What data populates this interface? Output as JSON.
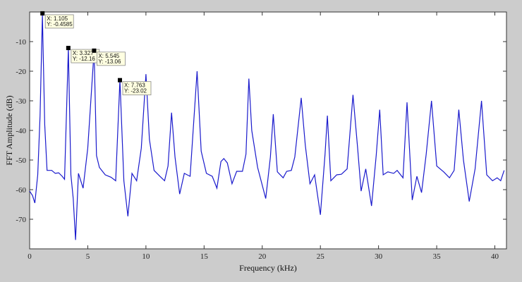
{
  "chart_data": {
    "type": "line",
    "title": "",
    "xlabel": "Frequency (kHz)",
    "ylabel": "FFT Amplitude (dB)",
    "xlim": [
      0,
      41
    ],
    "ylim": [
      -80,
      0
    ],
    "xticks": [
      0,
      5,
      10,
      15,
      20,
      25,
      30,
      35,
      40
    ],
    "yticks": [
      -10,
      -20,
      -30,
      -40,
      -50,
      -60,
      -70
    ],
    "grid": false,
    "series": [
      {
        "color": "#1a1acc",
        "points": [
          [
            0.0,
            -60.5
          ],
          [
            0.25,
            -62
          ],
          [
            0.45,
            -64.5
          ],
          [
            0.7,
            -55
          ],
          [
            0.9,
            -35
          ],
          [
            1.1,
            -1.0
          ],
          [
            1.3,
            -38
          ],
          [
            1.5,
            -53.5
          ],
          [
            1.9,
            -53.5
          ],
          [
            2.2,
            -54.5
          ],
          [
            2.5,
            -54.3
          ],
          [
            2.8,
            -55.5
          ],
          [
            3.0,
            -56.5
          ],
          [
            3.327,
            -12.3
          ],
          [
            3.55,
            -55
          ],
          [
            3.75,
            -63
          ],
          [
            3.95,
            -77
          ],
          [
            4.2,
            -54.5
          ],
          [
            4.6,
            -59.5
          ],
          [
            5.0,
            -46
          ],
          [
            5.545,
            -13.0
          ],
          [
            5.75,
            -48.5
          ],
          [
            6.0,
            -52.5
          ],
          [
            6.5,
            -55
          ],
          [
            7.0,
            -55.8
          ],
          [
            7.4,
            -57
          ],
          [
            7.763,
            -23.0
          ],
          [
            8.1,
            -57
          ],
          [
            8.45,
            -69
          ],
          [
            8.8,
            -54.5
          ],
          [
            9.2,
            -57
          ],
          [
            9.6,
            -46
          ],
          [
            10.0,
            -21
          ],
          [
            10.3,
            -43
          ],
          [
            10.7,
            -53.5
          ],
          [
            11.2,
            -55.5
          ],
          [
            11.6,
            -57
          ],
          [
            11.9,
            -52
          ],
          [
            12.2,
            -34
          ],
          [
            12.5,
            -49
          ],
          [
            12.9,
            -61.5
          ],
          [
            13.3,
            -54.5
          ],
          [
            13.8,
            -55.5
          ],
          [
            14.4,
            -20
          ],
          [
            14.75,
            -47
          ],
          [
            15.2,
            -54.5
          ],
          [
            15.7,
            -55.5
          ],
          [
            16.1,
            -59.5
          ],
          [
            16.45,
            -50.5
          ],
          [
            16.7,
            -49.5
          ],
          [
            17.0,
            -51
          ],
          [
            17.4,
            -58
          ],
          [
            17.8,
            -53.8
          ],
          [
            18.3,
            -53.8
          ],
          [
            18.6,
            -48
          ],
          [
            18.85,
            -22.5
          ],
          [
            19.1,
            -40
          ],
          [
            19.6,
            -52.5
          ],
          [
            20.3,
            -63
          ],
          [
            20.7,
            -49
          ],
          [
            20.95,
            -34.5
          ],
          [
            21.3,
            -54
          ],
          [
            21.8,
            -56
          ],
          [
            22.1,
            -53.8
          ],
          [
            22.5,
            -53.5
          ],
          [
            22.8,
            -49
          ],
          [
            23.35,
            -29
          ],
          [
            23.7,
            -45
          ],
          [
            24.1,
            -58
          ],
          [
            24.5,
            -55
          ],
          [
            25.0,
            -68.5
          ],
          [
            25.4,
            -48
          ],
          [
            25.6,
            -35
          ],
          [
            25.9,
            -57
          ],
          [
            26.4,
            -55
          ],
          [
            26.8,
            -54.8
          ],
          [
            27.3,
            -53
          ],
          [
            27.8,
            -28
          ],
          [
            28.2,
            -46
          ],
          [
            28.5,
            -60.5
          ],
          [
            28.9,
            -53
          ],
          [
            29.4,
            -65.5
          ],
          [
            29.8,
            -48.5
          ],
          [
            30.1,
            -33
          ],
          [
            30.4,
            -55
          ],
          [
            30.8,
            -54
          ],
          [
            31.3,
            -54.5
          ],
          [
            31.6,
            -53.5
          ],
          [
            32.1,
            -56
          ],
          [
            32.45,
            -30.5
          ],
          [
            32.9,
            -63.5
          ],
          [
            33.3,
            -55.5
          ],
          [
            33.7,
            -61
          ],
          [
            34.1,
            -48
          ],
          [
            34.55,
            -30
          ],
          [
            35.0,
            -52
          ],
          [
            35.6,
            -54
          ],
          [
            36.1,
            -56
          ],
          [
            36.5,
            -53.5
          ],
          [
            36.9,
            -33
          ],
          [
            37.3,
            -50
          ],
          [
            37.8,
            -64
          ],
          [
            38.3,
            -53
          ],
          [
            38.85,
            -30
          ],
          [
            39.3,
            -55
          ],
          [
            39.8,
            -57
          ],
          [
            40.2,
            -56
          ],
          [
            40.5,
            -57
          ],
          [
            40.8,
            -53.5
          ]
        ]
      }
    ],
    "datatips": [
      {
        "x": 1.105,
        "y": -0.4585,
        "x_text": "X: 1.105",
        "y_text": "Y: -0.4585"
      },
      {
        "x": 3.327,
        "y": -12.16,
        "x_text": "X: 3.327",
        "y_text": "Y: -12.16"
      },
      {
        "x": 5.545,
        "y": -13.06,
        "x_text": "X: 5.545",
        "y_text": "Y: -13.06"
      },
      {
        "x": 7.763,
        "y": -23.02,
        "x_text": "X: 7.763",
        "y_text": "Y: -23.02"
      }
    ]
  }
}
